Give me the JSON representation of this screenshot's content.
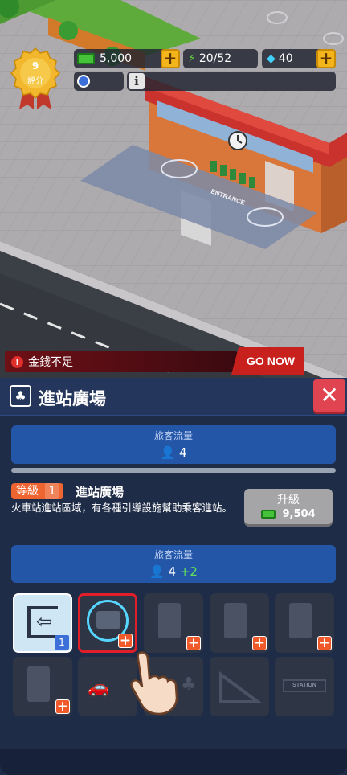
{
  "hud": {
    "rating_value": "9",
    "rating_label": "評分",
    "money": "5,000",
    "energy": "20/52",
    "gems": "40"
  },
  "alert": {
    "message": "金錢不足",
    "go_button": "GO NOW"
  },
  "scene": {
    "entrance_label": "ENTRANCE"
  },
  "panel": {
    "title": "進站廣場",
    "flow_label": "旅客流量",
    "flow_value": "4",
    "level_prefix": "等級",
    "level_number": "1",
    "facility_name": "進站廣場",
    "description": "火車站進站區域，有各種引導設施幫助乘客進站。",
    "upgrade_label": "升級",
    "upgrade_cost": "9,504",
    "next_flow_label": "旅客流量",
    "next_flow_value": "4",
    "next_flow_bonus": "+2"
  },
  "slots": {
    "entrance_level": "1",
    "station_sign_text": "STATION"
  }
}
